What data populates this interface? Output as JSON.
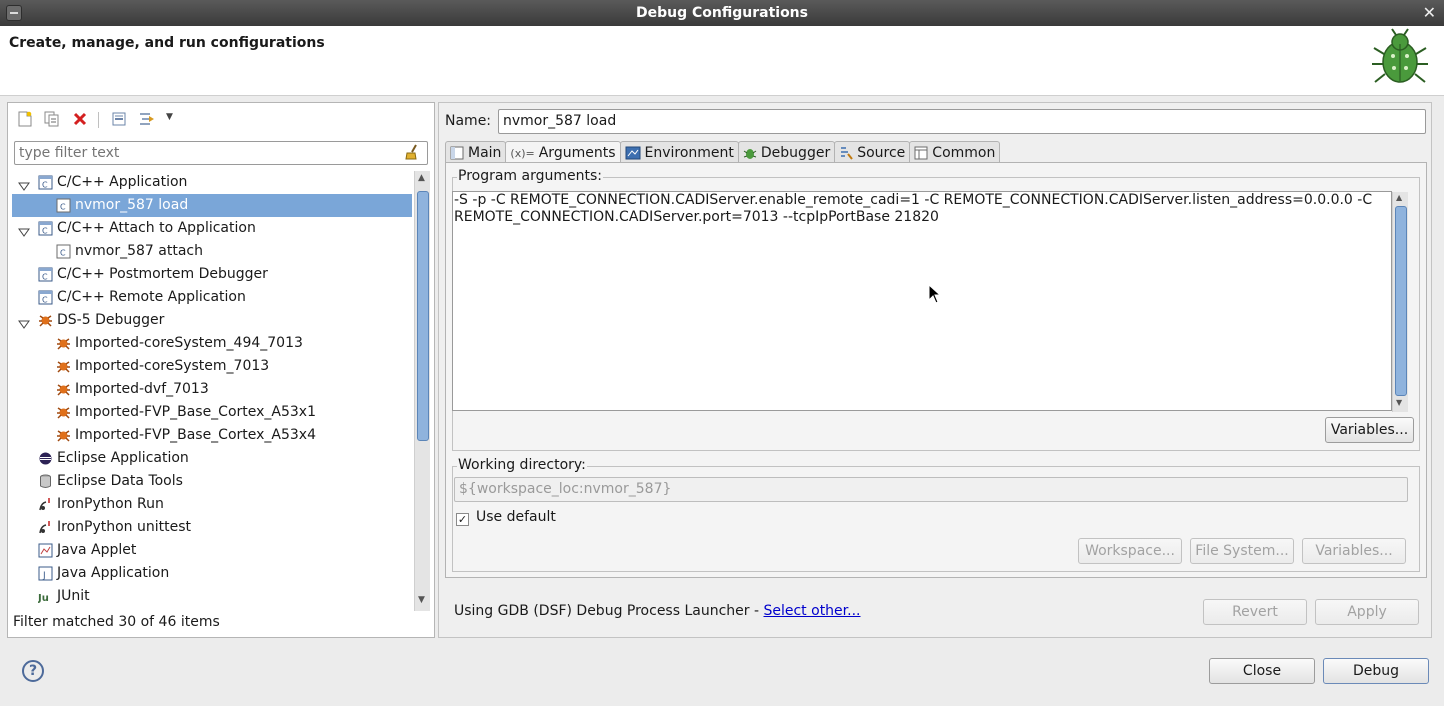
{
  "window": {
    "title": "Debug Configurations"
  },
  "header": {
    "title": "Create, manage, and run configurations",
    "logo_icon": "bug-icon"
  },
  "left": {
    "toolbar": [
      "new-configuration-icon",
      "duplicate-icon",
      "delete-icon",
      "collapse-all-icon",
      "filter-icon",
      "chevron-down-icon"
    ],
    "filter_placeholder": "type filter text",
    "tree": [
      {
        "label": "C/C++ Application",
        "level": 0,
        "expanded": true,
        "icon": "c-app-icon"
      },
      {
        "label": "nvmor_587 load",
        "level": 1,
        "selected": true,
        "icon": "c-config-icon"
      },
      {
        "label": "C/C++ Attach to Application",
        "level": 0,
        "expanded": true,
        "icon": "c-app-icon"
      },
      {
        "label": "nvmor_587 attach",
        "level": 1,
        "icon": "c-config-icon"
      },
      {
        "label": "C/C++ Postmortem Debugger",
        "level": 0,
        "icon": "c-app-icon"
      },
      {
        "label": "C/C++ Remote Application",
        "level": 0,
        "icon": "c-app-icon"
      },
      {
        "label": "DS-5 Debugger",
        "level": 0,
        "expanded": true,
        "icon": "ds5-icon"
      },
      {
        "label": "Imported-coreSystem_494_7013",
        "level": 1,
        "icon": "ds5-icon"
      },
      {
        "label": "Imported-coreSystem_7013",
        "level": 1,
        "icon": "ds5-icon"
      },
      {
        "label": "Imported-dvf_7013",
        "level": 1,
        "icon": "ds5-icon"
      },
      {
        "label": "Imported-FVP_Base_Cortex_A53x1",
        "level": 1,
        "icon": "ds5-icon"
      },
      {
        "label": "Imported-FVP_Base_Cortex_A53x4",
        "level": 1,
        "icon": "ds5-icon"
      },
      {
        "label": "Eclipse Application",
        "level": 0,
        "icon": "eclipse-icon"
      },
      {
        "label": "Eclipse Data Tools",
        "level": 0,
        "icon": "database-icon"
      },
      {
        "label": "IronPython Run",
        "level": 0,
        "icon": "python-icon"
      },
      {
        "label": "IronPython unittest",
        "level": 0,
        "icon": "python-icon"
      },
      {
        "label": "Java Applet",
        "level": 0,
        "icon": "applet-icon"
      },
      {
        "label": "Java Application",
        "level": 0,
        "icon": "java-icon"
      },
      {
        "label": "JUnit",
        "level": 0,
        "icon": "junit-icon"
      }
    ],
    "status": "Filter matched 30 of 46 items"
  },
  "right": {
    "name_label": "Name:",
    "name_value": "nvmor_587 load",
    "tabs": [
      {
        "label": "Main",
        "icon": "main-tab-icon"
      },
      {
        "label": "Arguments",
        "icon": "arguments-tab-icon",
        "active": true
      },
      {
        "label": "Environment",
        "icon": "environment-tab-icon"
      },
      {
        "label": "Debugger",
        "icon": "debugger-tab-icon"
      },
      {
        "label": "Source",
        "icon": "source-tab-icon"
      },
      {
        "label": "Common",
        "icon": "common-tab-icon"
      }
    ],
    "program_args_label": "Program arguments:",
    "program_args": "-S -p -C REMOTE_CONNECTION.CADIServer.enable_remote_cadi=1 -C REMOTE_CONNECTION.CADIServer.listen_address=0.0.0.0 -C\nREMOTE_CONNECTION.CADIServer.port=7013 --tcpIpPortBase 21820",
    "variables_button": "Variables...",
    "working_dir_label": "Working directory:",
    "working_dir_value": "${workspace_loc:nvmor_587}",
    "use_default_label": "Use default",
    "use_default_checked": true,
    "workspace_button": "Workspace...",
    "filesystem_button": "File System...",
    "variables2_button": "Variables...",
    "launcher_text": "Using GDB (DSF) Debug Process Launcher - ",
    "launcher_link": "Select other...",
    "revert_button": "Revert",
    "apply_button": "Apply"
  },
  "footer": {
    "close_button": "Close",
    "debug_button": "Debug"
  }
}
